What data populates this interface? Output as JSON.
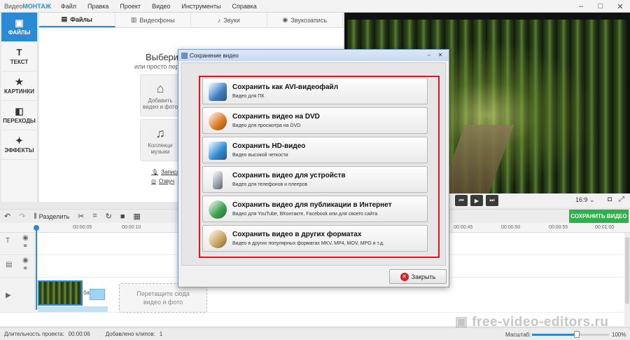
{
  "app": {
    "title_prefix": "Видео",
    "title_brand": "МОНТАЖ",
    "menu": [
      "Файл",
      "Правка",
      "Проект",
      "Видео",
      "Инструменты",
      "Справка"
    ],
    "window_controls": [
      "–",
      "□",
      "✕"
    ]
  },
  "sidebar": {
    "items": [
      {
        "label": "ФАЙЛЫ",
        "icon": "folder-icon",
        "glyph": "▣"
      },
      {
        "label": "ТЕКСТ",
        "icon": "text-icon",
        "glyph": "T"
      },
      {
        "label": "КАРТИНКИ",
        "icon": "star-icon",
        "glyph": "★"
      },
      {
        "label": "ПЕРЕХОДЫ",
        "icon": "transition-icon",
        "glyph": "◧"
      },
      {
        "label": "ЭФФЕКТЫ",
        "icon": "magic-wand-icon",
        "glyph": "✦"
      }
    ]
  },
  "tabs": [
    {
      "label": "Файлы",
      "glyph": "▤"
    },
    {
      "label": "Видеофоны",
      "glyph": "▥"
    },
    {
      "label": "Звуки",
      "glyph": "♪"
    },
    {
      "label": "Звукозапись",
      "glyph": "◉"
    }
  ],
  "content": {
    "title": "Выберит",
    "subtitle": "или просто пер",
    "tile1_label": "Добавить видео и фото",
    "tile2_label": "Коллекци музыки",
    "link1": "Записа",
    "link2": "Озвуч"
  },
  "player": {
    "aspect": "16:9 ⌄",
    "save_button": "СОХРАНИТЬ ВИДЕО"
  },
  "toolbar": {
    "split_label": "Разделить"
  },
  "ruler": [
    "00:00:05",
    "00:00:10",
    "00:00:45",
    "00:00:50",
    "00:00:55",
    "00:01:00"
  ],
  "timeline": {
    "drop_zone": "Перетащите сюда видео и фото",
    "clip_label": "ба"
  },
  "status": {
    "duration_label": "Длительность проекта:",
    "duration_value": "00:00:06",
    "clips_label": "Добавлено клипов:",
    "clips_value": "1",
    "zoom_label": "Масштаб:",
    "zoom_value": "100%",
    "zoom_level": 0.58
  },
  "watermark": "free-video-editors.ru",
  "dialog": {
    "title": "Сохранение видео",
    "options": [
      {
        "title": "Сохранить как AVI-видеофайл",
        "subtitle": "Видео для ПК",
        "icon": "pc-icon",
        "color": "#3a7fc4"
      },
      {
        "title": "Сохранить видео на DVD",
        "subtitle": "Видео для просмотра на DVD",
        "icon": "dvd-icon",
        "color": "#e07a1f"
      },
      {
        "title": "Сохранить HD-видео",
        "subtitle": "Видео высокой четкости",
        "icon": "hd-monitor-icon",
        "color": "#2b8ad4"
      },
      {
        "title": "Сохранить видео для устройств",
        "subtitle": "Видео для телефонов и плееров",
        "icon": "phone-icon",
        "color": "#9aa3ad"
      },
      {
        "title": "Сохранить видео для публикации в Интернет",
        "subtitle": "Видео для YouTube, ВКонтакте, Facebook или для своего сайта",
        "icon": "globe-icon",
        "color": "#3aa04a"
      },
      {
        "title": "Сохранить видео в других форматах",
        "subtitle": "Видео в других популярных форматах MKV, MP4, MOV, MPG и т.д.",
        "icon": "film-reel-icon",
        "color": "#c9a35a"
      }
    ],
    "close_label": "Закрыть",
    "highlight_color": "#e0141e"
  }
}
